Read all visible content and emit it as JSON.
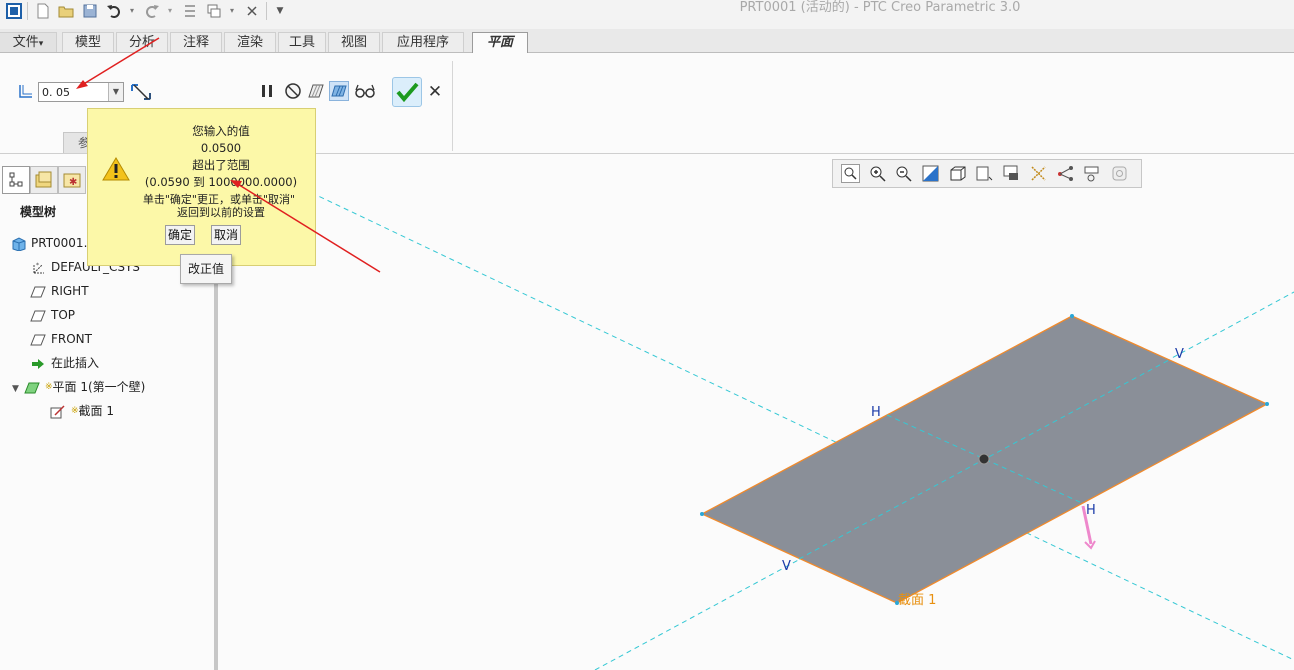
{
  "app": {
    "title": "PRT0001 (活动的) - PTC Creo Parametric 3.0"
  },
  "quick_access": {
    "icons": [
      "app-icon",
      "new-icon",
      "open-icon",
      "save-icon",
      "undo-icon",
      "redo-icon",
      "regenerate-icon",
      "windows-icon",
      "close-window-icon",
      "customize-icon"
    ]
  },
  "ribbon": {
    "tabs": [
      {
        "label": "文件",
        "dropdown": "▾"
      },
      {
        "label": "模型"
      },
      {
        "label": "分析"
      },
      {
        "label": "注释"
      },
      {
        "label": "渲染"
      },
      {
        "label": "工具"
      },
      {
        "label": "视图"
      },
      {
        "label": "应用程序"
      },
      {
        "label": "平面",
        "active": true
      }
    ],
    "thickness_value": "0. 05",
    "param_tab": "参"
  },
  "left_panel": {
    "title": "模型树",
    "tree": [
      {
        "label": "PRT0001.P",
        "icon": "part-icon"
      },
      {
        "label": "DEFAULT_CSYS",
        "icon": "csys-icon"
      },
      {
        "label": "RIGHT",
        "icon": "datum-plane-icon"
      },
      {
        "label": "TOP",
        "icon": "datum-plane-icon"
      },
      {
        "label": "FRONT",
        "icon": "datum-plane-icon"
      },
      {
        "label": "在此插入",
        "icon": "insert-here-icon"
      },
      {
        "label": "平面 1(第一个壁)",
        "icon": "planar-wall-icon",
        "marker": "※"
      },
      {
        "label": "截面 1",
        "icon": "sketch-icon",
        "marker": "※"
      }
    ]
  },
  "popup": {
    "lines": [
      "您输入的值",
      "0.0500",
      "超出了范围",
      "(0.0590 到 1000000.0000)",
      "单击\"确定\"更正，或单击\"取消\"",
      "返回到以前的设置"
    ],
    "ok_label": "确定",
    "cancel_label": "取消",
    "tooltip": "改正值"
  },
  "graphics": {
    "labels": {
      "h_top": "H",
      "v_right": "V",
      "h_bottom": "H",
      "v_left": "V",
      "section": "截面 1"
    },
    "colors": {
      "sheet_fill": "#8a8f98",
      "sheet_edge": "#f08a2c",
      "datum_line": "#35c8d4",
      "annotation_arrow": "#e02020",
      "direction_arrow": "#ee88cc",
      "section_label": "#e89010",
      "hv_label": "#1a3aa8"
    }
  },
  "view_toolbar": {
    "icons": [
      "refit-icon",
      "zoom-in-icon",
      "zoom-out-icon",
      "repaint-icon",
      "display-style-icon",
      "saved-orientations-icon",
      "view-manager-icon",
      "datum-display-icon",
      "annotation-display-icon",
      "spin-center-icon",
      "section-display-icon"
    ]
  }
}
